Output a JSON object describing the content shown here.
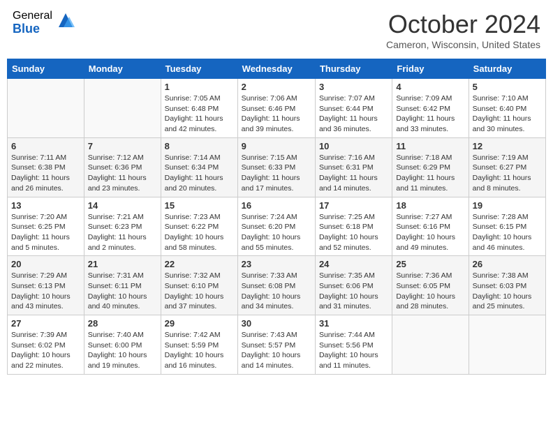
{
  "header": {
    "logo_general": "General",
    "logo_blue": "Blue",
    "month_title": "October 2024",
    "location": "Cameron, Wisconsin, United States"
  },
  "days_of_week": [
    "Sunday",
    "Monday",
    "Tuesday",
    "Wednesday",
    "Thursday",
    "Friday",
    "Saturday"
  ],
  "weeks": [
    [
      {
        "day": "",
        "empty": true
      },
      {
        "day": "",
        "empty": true
      },
      {
        "day": "1",
        "sunrise": "Sunrise: 7:05 AM",
        "sunset": "Sunset: 6:48 PM",
        "daylight": "Daylight: 11 hours and 42 minutes."
      },
      {
        "day": "2",
        "sunrise": "Sunrise: 7:06 AM",
        "sunset": "Sunset: 6:46 PM",
        "daylight": "Daylight: 11 hours and 39 minutes."
      },
      {
        "day": "3",
        "sunrise": "Sunrise: 7:07 AM",
        "sunset": "Sunset: 6:44 PM",
        "daylight": "Daylight: 11 hours and 36 minutes."
      },
      {
        "day": "4",
        "sunrise": "Sunrise: 7:09 AM",
        "sunset": "Sunset: 6:42 PM",
        "daylight": "Daylight: 11 hours and 33 minutes."
      },
      {
        "day": "5",
        "sunrise": "Sunrise: 7:10 AM",
        "sunset": "Sunset: 6:40 PM",
        "daylight": "Daylight: 11 hours and 30 minutes."
      }
    ],
    [
      {
        "day": "6",
        "sunrise": "Sunrise: 7:11 AM",
        "sunset": "Sunset: 6:38 PM",
        "daylight": "Daylight: 11 hours and 26 minutes."
      },
      {
        "day": "7",
        "sunrise": "Sunrise: 7:12 AM",
        "sunset": "Sunset: 6:36 PM",
        "daylight": "Daylight: 11 hours and 23 minutes."
      },
      {
        "day": "8",
        "sunrise": "Sunrise: 7:14 AM",
        "sunset": "Sunset: 6:34 PM",
        "daylight": "Daylight: 11 hours and 20 minutes."
      },
      {
        "day": "9",
        "sunrise": "Sunrise: 7:15 AM",
        "sunset": "Sunset: 6:33 PM",
        "daylight": "Daylight: 11 hours and 17 minutes."
      },
      {
        "day": "10",
        "sunrise": "Sunrise: 7:16 AM",
        "sunset": "Sunset: 6:31 PM",
        "daylight": "Daylight: 11 hours and 14 minutes."
      },
      {
        "day": "11",
        "sunrise": "Sunrise: 7:18 AM",
        "sunset": "Sunset: 6:29 PM",
        "daylight": "Daylight: 11 hours and 11 minutes."
      },
      {
        "day": "12",
        "sunrise": "Sunrise: 7:19 AM",
        "sunset": "Sunset: 6:27 PM",
        "daylight": "Daylight: 11 hours and 8 minutes."
      }
    ],
    [
      {
        "day": "13",
        "sunrise": "Sunrise: 7:20 AM",
        "sunset": "Sunset: 6:25 PM",
        "daylight": "Daylight: 11 hours and 5 minutes."
      },
      {
        "day": "14",
        "sunrise": "Sunrise: 7:21 AM",
        "sunset": "Sunset: 6:23 PM",
        "daylight": "Daylight: 11 hours and 2 minutes."
      },
      {
        "day": "15",
        "sunrise": "Sunrise: 7:23 AM",
        "sunset": "Sunset: 6:22 PM",
        "daylight": "Daylight: 10 hours and 58 minutes."
      },
      {
        "day": "16",
        "sunrise": "Sunrise: 7:24 AM",
        "sunset": "Sunset: 6:20 PM",
        "daylight": "Daylight: 10 hours and 55 minutes."
      },
      {
        "day": "17",
        "sunrise": "Sunrise: 7:25 AM",
        "sunset": "Sunset: 6:18 PM",
        "daylight": "Daylight: 10 hours and 52 minutes."
      },
      {
        "day": "18",
        "sunrise": "Sunrise: 7:27 AM",
        "sunset": "Sunset: 6:16 PM",
        "daylight": "Daylight: 10 hours and 49 minutes."
      },
      {
        "day": "19",
        "sunrise": "Sunrise: 7:28 AM",
        "sunset": "Sunset: 6:15 PM",
        "daylight": "Daylight: 10 hours and 46 minutes."
      }
    ],
    [
      {
        "day": "20",
        "sunrise": "Sunrise: 7:29 AM",
        "sunset": "Sunset: 6:13 PM",
        "daylight": "Daylight: 10 hours and 43 minutes."
      },
      {
        "day": "21",
        "sunrise": "Sunrise: 7:31 AM",
        "sunset": "Sunset: 6:11 PM",
        "daylight": "Daylight: 10 hours and 40 minutes."
      },
      {
        "day": "22",
        "sunrise": "Sunrise: 7:32 AM",
        "sunset": "Sunset: 6:10 PM",
        "daylight": "Daylight: 10 hours and 37 minutes."
      },
      {
        "day": "23",
        "sunrise": "Sunrise: 7:33 AM",
        "sunset": "Sunset: 6:08 PM",
        "daylight": "Daylight: 10 hours and 34 minutes."
      },
      {
        "day": "24",
        "sunrise": "Sunrise: 7:35 AM",
        "sunset": "Sunset: 6:06 PM",
        "daylight": "Daylight: 10 hours and 31 minutes."
      },
      {
        "day": "25",
        "sunrise": "Sunrise: 7:36 AM",
        "sunset": "Sunset: 6:05 PM",
        "daylight": "Daylight: 10 hours and 28 minutes."
      },
      {
        "day": "26",
        "sunrise": "Sunrise: 7:38 AM",
        "sunset": "Sunset: 6:03 PM",
        "daylight": "Daylight: 10 hours and 25 minutes."
      }
    ],
    [
      {
        "day": "27",
        "sunrise": "Sunrise: 7:39 AM",
        "sunset": "Sunset: 6:02 PM",
        "daylight": "Daylight: 10 hours and 22 minutes."
      },
      {
        "day": "28",
        "sunrise": "Sunrise: 7:40 AM",
        "sunset": "Sunset: 6:00 PM",
        "daylight": "Daylight: 10 hours and 19 minutes."
      },
      {
        "day": "29",
        "sunrise": "Sunrise: 7:42 AM",
        "sunset": "Sunset: 5:59 PM",
        "daylight": "Daylight: 10 hours and 16 minutes."
      },
      {
        "day": "30",
        "sunrise": "Sunrise: 7:43 AM",
        "sunset": "Sunset: 5:57 PM",
        "daylight": "Daylight: 10 hours and 14 minutes."
      },
      {
        "day": "31",
        "sunrise": "Sunrise: 7:44 AM",
        "sunset": "Sunset: 5:56 PM",
        "daylight": "Daylight: 10 hours and 11 minutes."
      },
      {
        "day": "",
        "empty": true
      },
      {
        "day": "",
        "empty": true
      }
    ]
  ]
}
